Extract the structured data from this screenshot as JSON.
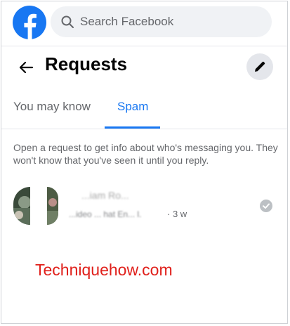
{
  "search": {
    "placeholder": "Search Facebook"
  },
  "header": {
    "title": "Requests"
  },
  "tabs": [
    {
      "label": "You may know",
      "active": false
    },
    {
      "label": "Spam",
      "active": true
    }
  ],
  "info_text": "Open a request to get info about who's messaging you. They won't know that you've seen it until you reply.",
  "requests": [
    {
      "name": "...iam Ro...",
      "preview": "...ideo ... hat En... l.",
      "time": "· 3 w"
    }
  ],
  "watermark": "Techniquehow.com",
  "colors": {
    "brand": "#1877f2",
    "watermark": "#e0201b",
    "muted": "#65676b"
  }
}
